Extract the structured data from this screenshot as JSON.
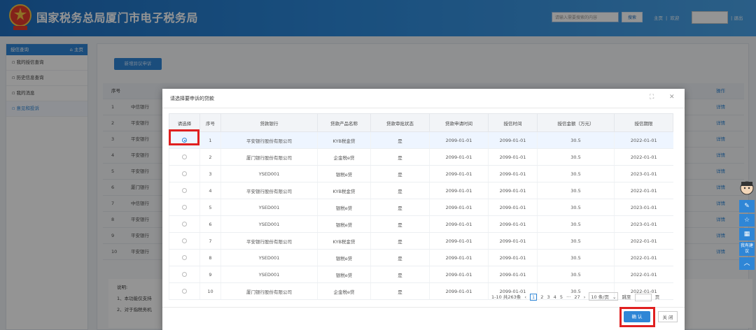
{
  "header": {
    "title": "国家税务总局厦门市电子税务局",
    "search_placeholder": "请输入需要搜索的内容",
    "search_button": "搜索",
    "home_link": "主页",
    "welcome_label": "欢迎",
    "logout_link": "退出"
  },
  "sidebar": {
    "heading": "授信查询",
    "home_link": "主页",
    "items": [
      {
        "label": "我的授信查询"
      },
      {
        "label": "历史信息查询"
      },
      {
        "label": "我的消息"
      },
      {
        "label": "意见和投诉"
      }
    ]
  },
  "main": {
    "add_button": "新增异议申诉",
    "table_header": {
      "index": "序号",
      "op": "操作"
    },
    "rows": [
      {
        "index": "1",
        "bank": "中信银行",
        "op": "详情"
      },
      {
        "index": "2",
        "bank": "平安银行",
        "op": "详情"
      },
      {
        "index": "3",
        "bank": "平安银行",
        "op": "详情"
      },
      {
        "index": "4",
        "bank": "平安银行",
        "op": "详情"
      },
      {
        "index": "5",
        "bank": "平安银行",
        "op": "详情"
      },
      {
        "index": "6",
        "bank": "厦门银行",
        "op": "详情"
      },
      {
        "index": "7",
        "bank": "中信银行",
        "op": "详情"
      },
      {
        "index": "8",
        "bank": "平安银行",
        "op": "详情"
      },
      {
        "index": "9",
        "bank": "平安银行",
        "op": "详情"
      },
      {
        "index": "10",
        "bank": "平安银行",
        "op": "详情"
      }
    ],
    "notes": [
      "说明:",
      "1、本功能仅支持",
      "2、对于指税务机"
    ]
  },
  "dialog": {
    "title": "请选择要申诉的贷款",
    "columns": [
      "请选择",
      "序号",
      "贷款银行",
      "贷款产品名称",
      "贷款审批状态",
      "贷款申请时间",
      "授信时间",
      "授信金额（万元）",
      "授信期限"
    ],
    "rows": [
      {
        "no": "1",
        "bank": "平安银行股份有限公司",
        "product": "KYB税金贷",
        "status": "是",
        "apply": "2099-01-01",
        "credit": "2099-01-01",
        "amount": "30.5",
        "term": "2022-01-01",
        "selected": true
      },
      {
        "no": "2",
        "bank": "厦门银行股份有限公司",
        "product": "企金税e贷",
        "status": "是",
        "apply": "2099-01-01",
        "credit": "2099-01-01",
        "amount": "30.5",
        "term": "2022-01-01",
        "selected": false
      },
      {
        "no": "3",
        "bank": "YSED001",
        "product": "银税e贷",
        "status": "是",
        "apply": "2099-01-01",
        "credit": "2099-01-01",
        "amount": "30.5",
        "term": "2023-01-01",
        "selected": false
      },
      {
        "no": "4",
        "bank": "平安银行股份有限公司",
        "product": "KYB税金贷",
        "status": "是",
        "apply": "2099-01-01",
        "credit": "2099-01-01",
        "amount": "30.5",
        "term": "2022-01-01",
        "selected": false
      },
      {
        "no": "5",
        "bank": "YSED001",
        "product": "银税e贷",
        "status": "是",
        "apply": "2099-01-01",
        "credit": "2099-01-01",
        "amount": "30.5",
        "term": "2023-01-01",
        "selected": false
      },
      {
        "no": "6",
        "bank": "YSED001",
        "product": "银税e贷",
        "status": "是",
        "apply": "2099-01-01",
        "credit": "2099-01-01",
        "amount": "30.5",
        "term": "2023-01-01",
        "selected": false
      },
      {
        "no": "7",
        "bank": "平安银行股份有限公司",
        "product": "KYB税金贷",
        "status": "是",
        "apply": "2099-01-01",
        "credit": "2099-01-01",
        "amount": "30.5",
        "term": "2022-01-01",
        "selected": false
      },
      {
        "no": "8",
        "bank": "YSED001",
        "product": "银税e贷",
        "status": "是",
        "apply": "2099-01-01",
        "credit": "2099-01-01",
        "amount": "30.5",
        "term": "2022-01-01",
        "selected": false
      },
      {
        "no": "9",
        "bank": "YSED001",
        "product": "银税e贷",
        "status": "是",
        "apply": "2099-01-01",
        "credit": "2099-01-01",
        "amount": "30.5",
        "term": "2022-01-01",
        "selected": false
      },
      {
        "no": "10",
        "bank": "厦门银行股份有限公司",
        "product": "企金税e贷",
        "status": "是",
        "apply": "2099-01-01",
        "credit": "2099-01-01",
        "amount": "30.5",
        "term": "2022-01-01",
        "selected": false
      }
    ],
    "pager": {
      "summary": "1-10 共263条",
      "current": "1",
      "pages": [
        "2",
        "3",
        "4",
        "5"
      ],
      "ellipsis": "···",
      "last": "27",
      "page_size": "10 条/页",
      "goto_label": "跳至",
      "page_unit": "页"
    },
    "confirm_button": "确 认",
    "close_button": "关 闭"
  },
  "float": {
    "suggest": "我有建议"
  },
  "colors": {
    "brand": "#2f86d6",
    "highlight": "#e02020"
  }
}
